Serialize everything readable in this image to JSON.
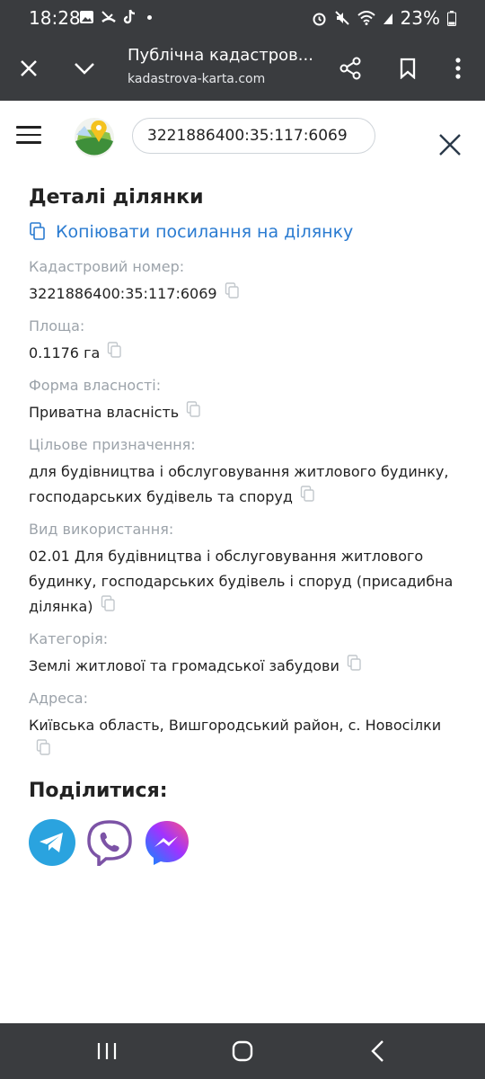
{
  "status": {
    "time": "18:28",
    "battery": "23%"
  },
  "browser": {
    "title": "Публічна кадастров...",
    "url": "kadastrova-karta.com"
  },
  "app": {
    "search_value": "3221886400:35:117:6069"
  },
  "details": {
    "heading": "Деталі ділянки",
    "copy_link": "Копіювати посилання на ділянку",
    "fields": [
      {
        "label": "Кадастровий номер:",
        "value": "3221886400:35:117:6069"
      },
      {
        "label": "Площа:",
        "value": "0.1176 га"
      },
      {
        "label": "Форма власності:",
        "value": "Приватна власність"
      },
      {
        "label": "Цільове призначення:",
        "value": "для будівництва і обслуговування житлового будинку, господарських будівель та споруд"
      },
      {
        "label": "Вид використання:",
        "value": "02.01 Для будівництва і обслуговування житлового будинку, господарських будівель і споруд (присадибна ділянка)"
      },
      {
        "label": "Категорія:",
        "value": "Землі житлової та громадської забудови"
      },
      {
        "label": "Адреса:",
        "value": "Київська область, Вишгородський район, с. Новосілки"
      }
    ]
  },
  "share": {
    "heading": "Поділитися:",
    "items": [
      {
        "icon": "telegram-icon",
        "color": "#2aa3df"
      },
      {
        "icon": "viber-icon",
        "color": "#7c53a6"
      },
      {
        "icon": "messenger-icon",
        "color": "#8a46ff"
      }
    ]
  }
}
